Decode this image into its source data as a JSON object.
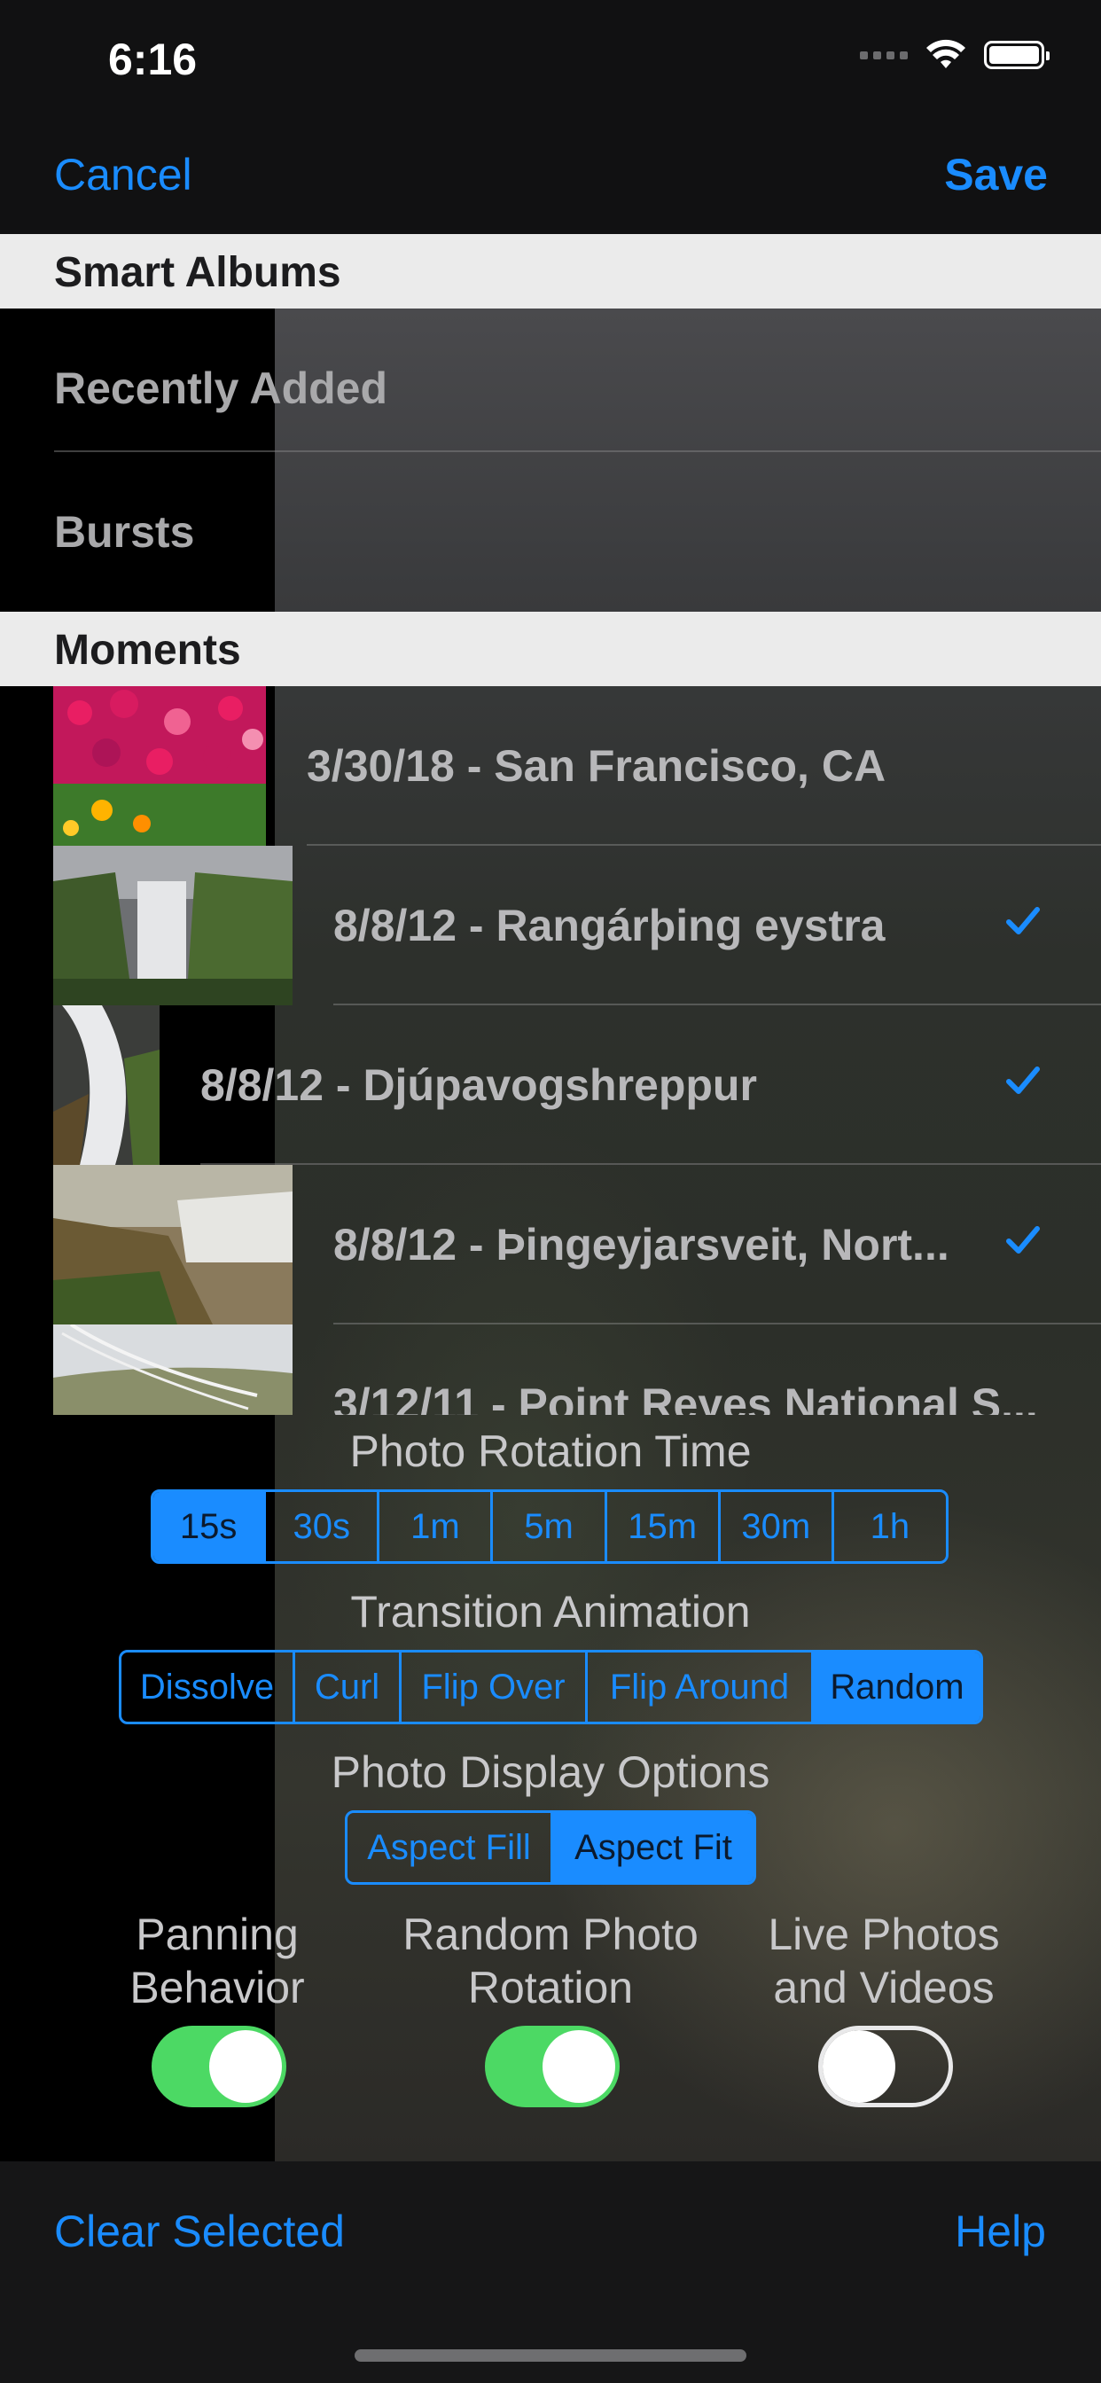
{
  "status_bar": {
    "time": "6:16"
  },
  "nav": {
    "cancel_label": "Cancel",
    "save_label": "Save"
  },
  "smart_albums": {
    "header": "Smart Albums",
    "items": [
      {
        "label": "Recently Added"
      },
      {
        "label": "Bursts"
      }
    ]
  },
  "moments": {
    "header": "Moments",
    "items": [
      {
        "label": "3/30/18 - San Francisco, CA",
        "selected": false
      },
      {
        "label": "8/8/12 - Rangárþing eystra",
        "selected": true
      },
      {
        "label": "8/8/12 - Djúpavogshreppur",
        "selected": true
      },
      {
        "label": "8/8/12 - Þingeyjarsveit, Nort...",
        "selected": true
      },
      {
        "label": "3/12/11 - Point Reyes National S...",
        "selected": false
      }
    ]
  },
  "rotation_time": {
    "title": "Photo Rotation Time",
    "options": [
      "15s",
      "30s",
      "1m",
      "5m",
      "15m",
      "30m",
      "1h"
    ],
    "selected": "15s"
  },
  "transition": {
    "title": "Transition Animation",
    "options": [
      "Dissolve",
      "Curl",
      "Flip Over",
      "Flip Around",
      "Random"
    ],
    "selected": "Random"
  },
  "display_options": {
    "title": "Photo Display Options",
    "options": [
      "Aspect Fill",
      "Aspect Fit"
    ],
    "selected": "Aspect Fit"
  },
  "toggles": {
    "panning": {
      "line1": "Panning",
      "line2": "Behavior",
      "on": true
    },
    "random_rotation": {
      "line1": "Random Photo",
      "line2": "Rotation",
      "on": true
    },
    "live_photos": {
      "line1": "Live Photos",
      "line2": "and Videos",
      "on": false
    }
  },
  "bottom": {
    "clear_label": "Clear Selected",
    "help_label": "Help"
  },
  "colors": {
    "accent": "#1a8cff",
    "toggle_on": "#4cd964",
    "header_bg": "#ebebeb"
  }
}
